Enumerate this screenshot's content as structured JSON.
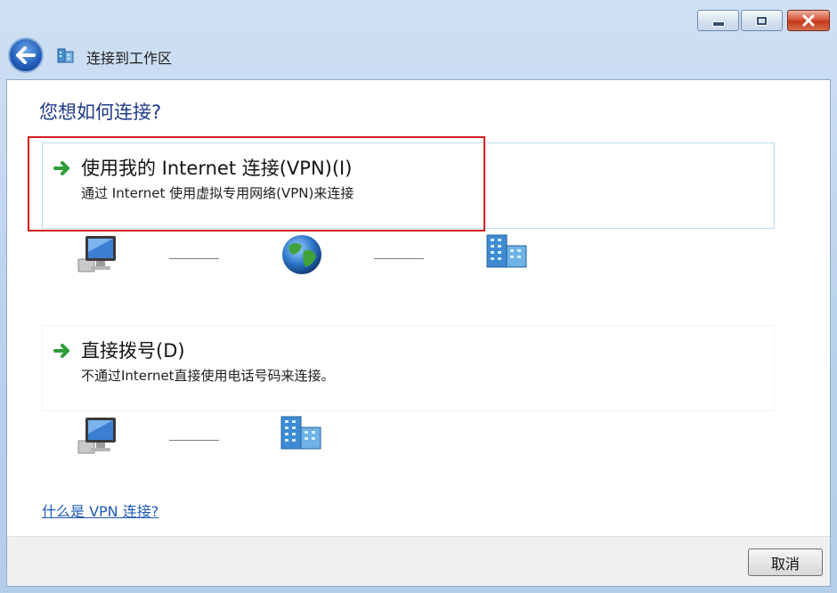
{
  "window": {
    "title": "连接到工作区",
    "buttons": {
      "minimize": "minimize-icon",
      "maximize": "maximize-icon",
      "close": "close-icon"
    }
  },
  "heading": "您想如何连接?",
  "options": [
    {
      "title": "使用我的 Internet 连接(VPN)(I)",
      "description": "通过 Internet 使用虚拟专用网络(VPN)来连接",
      "diagram": [
        "computer-icon",
        "globe-icon",
        "workplace-building-icon"
      ]
    },
    {
      "title": "直接拨号(D)",
      "description": "不通过Internet直接使用电话号码来连接。",
      "diagram": [
        "computer-icon",
        "workplace-building-icon"
      ]
    }
  ],
  "help_link": "什么是 VPN 连接?",
  "footer": {
    "cancel_label": "取消"
  },
  "colors": {
    "heading": "#1f3a8a",
    "link": "#1f5ab8",
    "highlight_frame": "#d42020",
    "arrow": "#2e9d3a"
  }
}
